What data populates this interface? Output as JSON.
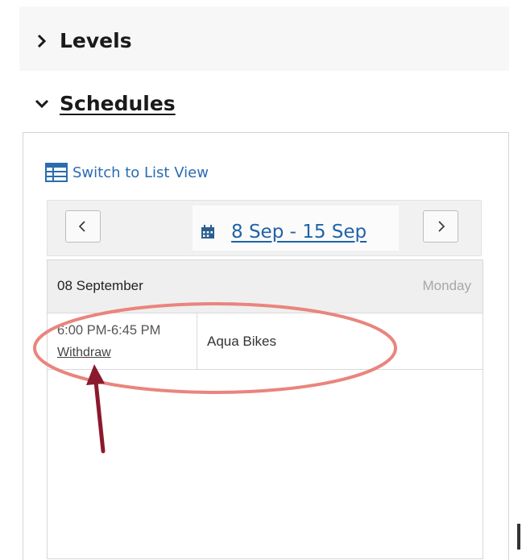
{
  "sections": {
    "levels": {
      "label": "Levels",
      "expanded": false
    },
    "schedules": {
      "label": "Schedules",
      "expanded": true
    }
  },
  "schedule": {
    "list_view_label": "Switch to List View",
    "date_range": "8 Sep - 15 Sep",
    "day": {
      "date": "08 September",
      "weekday": "Monday",
      "entries": [
        {
          "time": "6:00 PM-6:45 PM",
          "action": "Withdraw",
          "class_name": "Aqua Bikes"
        }
      ]
    }
  },
  "colors": {
    "link_blue": "#1f63a8",
    "annotation_ellipse": "#e9857d",
    "annotation_arrow": "#8b1a2e"
  },
  "icons": [
    "chevron-right-icon",
    "chevron-down-icon",
    "list-view-icon",
    "chevron-left-icon",
    "calendar-icon"
  ]
}
